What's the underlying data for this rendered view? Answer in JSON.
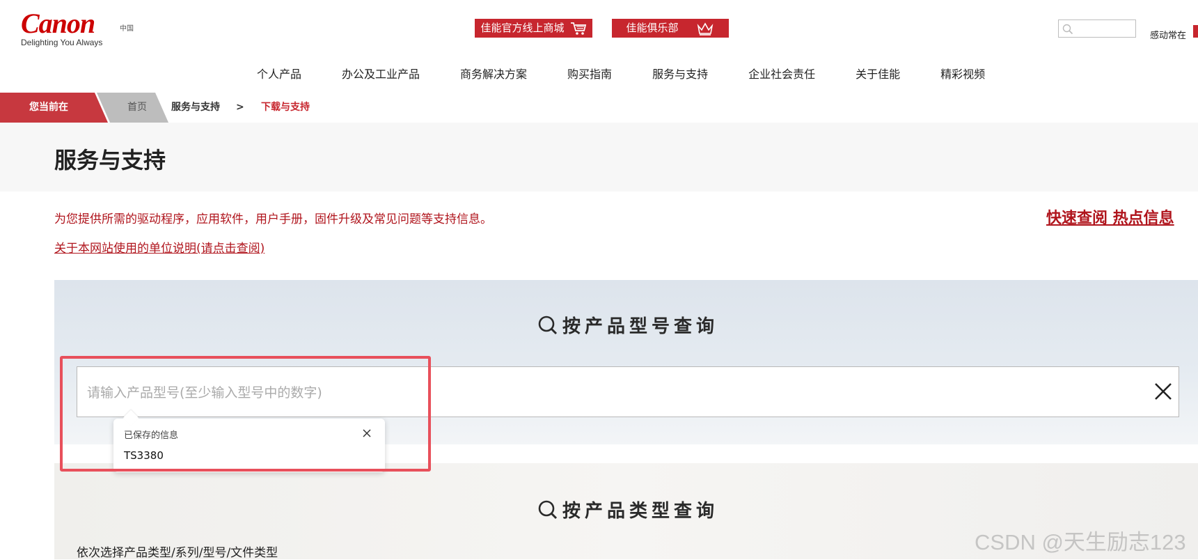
{
  "header": {
    "logo_text": "Canon",
    "region": "中国",
    "tagline": "Delighting You Always",
    "shop_button": "佳能官方线上商城",
    "club_button": "佳能俱乐部",
    "slogan": "感动常在"
  },
  "nav": {
    "items": [
      {
        "label": "个人产品"
      },
      {
        "label": "办公及工业产品"
      },
      {
        "label": "商务解决方案"
      },
      {
        "label": "购买指南"
      },
      {
        "label": "服务与支持"
      },
      {
        "label": "企业社会责任"
      },
      {
        "label": "关于佳能"
      },
      {
        "label": "精彩视频"
      }
    ]
  },
  "breadcrumb": {
    "here_label": "您当前在",
    "home": "首页",
    "section": "服务与支持",
    "separator": ">",
    "current": "下载与支持"
  },
  "page": {
    "title": "服务与支持",
    "intro": "为您提供所需的驱动程序，应用软件，用户手册，固件升级及常见问题等支持信息。",
    "unit_link": "关于本网站使用的单位说明(请点击查阅)",
    "quick_link": "快速查阅 热点信息"
  },
  "model_search": {
    "heading": "按产品型号查询",
    "placeholder": "请输入产品型号(至少输入型号中的数字)",
    "value": ""
  },
  "saved_popup": {
    "title": "已保存的信息",
    "items": [
      "TS3380"
    ]
  },
  "type_search": {
    "heading": "按产品类型查询",
    "hint": "依次选择产品类型/系列/型号/文件类型"
  },
  "watermark": "CSDN @天生励志123",
  "colors": {
    "brand_red": "#c7262e",
    "link_red": "#b0151d",
    "highlight": "#e8505b"
  }
}
